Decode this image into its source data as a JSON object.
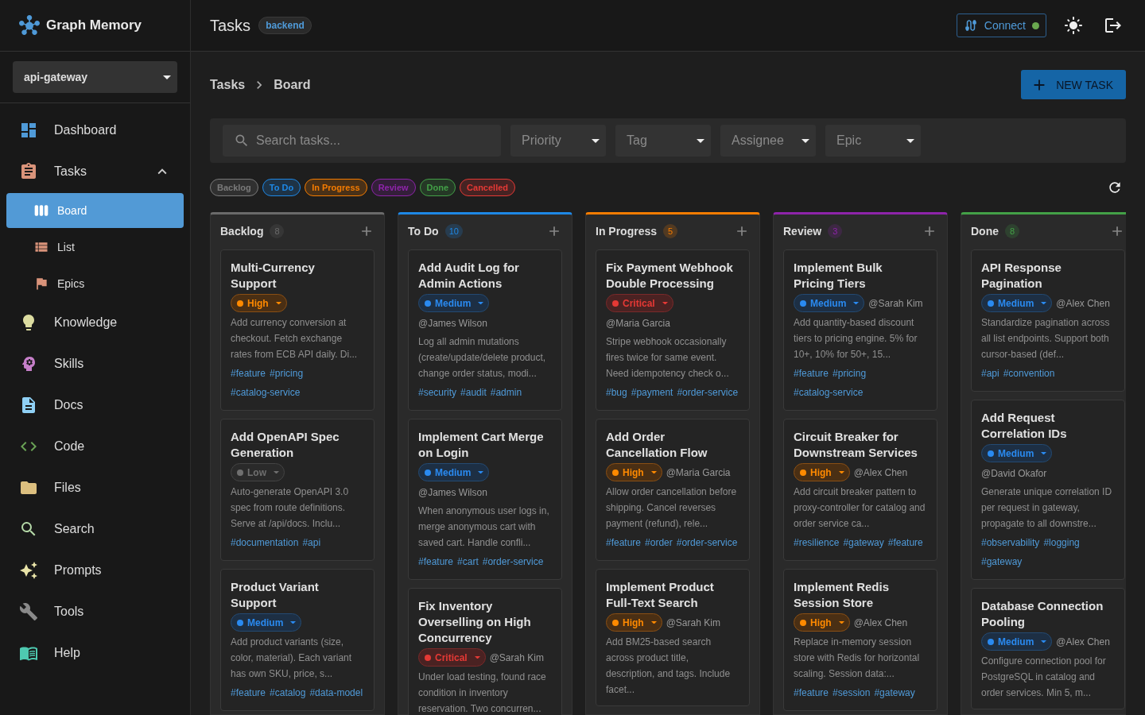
{
  "app": {
    "name": "Graph Memory"
  },
  "project_select": {
    "value": "api-gateway"
  },
  "sidebar": {
    "items": [
      {
        "label": "Dashboard",
        "color": "#4f9ad8",
        "selected": false
      },
      {
        "label": "Tasks",
        "color": "#d9937a",
        "selected": false,
        "expanded": true,
        "children": [
          {
            "label": "Board",
            "color": "#ffffff",
            "selected": true
          },
          {
            "label": "List",
            "color": "#d9937a",
            "selected": false
          },
          {
            "label": "Epics",
            "color": "#d9937a",
            "selected": false
          }
        ]
      },
      {
        "label": "Knowledge",
        "color": "#dcdca0",
        "selected": false
      },
      {
        "label": "Skills",
        "color": "#c67fc9",
        "selected": false
      },
      {
        "label": "Docs",
        "color": "#8fd0f5",
        "selected": false
      },
      {
        "label": "Code",
        "color": "#6aa356",
        "selected": false
      },
      {
        "label": "Files",
        "color": "#dcbf7f",
        "selected": false
      },
      {
        "label": "Search",
        "color": "#b5d9a8",
        "selected": false
      },
      {
        "label": "Prompts",
        "color": "#e8e3a8",
        "selected": false
      },
      {
        "label": "Tools",
        "color": "#8a8a8a",
        "selected": false
      },
      {
        "label": "Help",
        "color": "#4ec9b0",
        "selected": false
      }
    ]
  },
  "header": {
    "title": "Tasks",
    "badge": "backend",
    "connect": {
      "label": "Connect",
      "connected": true
    }
  },
  "breadcrumb": [
    "Tasks",
    "Board"
  ],
  "new_task_button": "NEW TASK",
  "filters": {
    "search": {
      "placeholder": "Search tasks..."
    },
    "selects": [
      "Priority",
      "Tag",
      "Assignee",
      "Epic"
    ]
  },
  "status_chips": [
    {
      "label": "Backlog",
      "color": "#7a7a7a"
    },
    {
      "label": "To Do",
      "color": "#1e88e5"
    },
    {
      "label": "In Progress",
      "color": "#f57c00"
    },
    {
      "label": "Review",
      "color": "#8e24aa"
    },
    {
      "label": "Done",
      "color": "#43a047"
    },
    {
      "label": "Cancelled",
      "color": "#e53935"
    }
  ],
  "columns": [
    {
      "title": "Backlog",
      "count": "8",
      "color": "#6a6a6a",
      "cards": [
        {
          "title": "Multi-Currency Support",
          "priority": {
            "label": "High",
            "kind": "high"
          },
          "description": "Add currency conversion at checkout. Fetch exchange rates from ECB API daily. Di...",
          "tags": [
            "#feature",
            "#pricing",
            "#catalog-service"
          ]
        },
        {
          "title": "Add OpenAPI Spec Generation",
          "priority": {
            "label": "Low",
            "kind": "low"
          },
          "description": "Auto-generate OpenAPI 3.0 spec from route definitions. Serve at /api/docs. Inclu...",
          "tags": [
            "#documentation",
            "#api"
          ]
        },
        {
          "title": "Product Variant Support",
          "priority": {
            "label": "Medium",
            "kind": "medium"
          },
          "description": "Add product variants (size, color, material). Each variant has own SKU, price, s...",
          "tags": [
            "#feature",
            "#catalog",
            "#data-model"
          ]
        }
      ]
    },
    {
      "title": "To Do",
      "count": "10",
      "color": "#1e88e5",
      "cards": [
        {
          "title": "Add Audit Log for Admin Actions",
          "priority": {
            "label": "Medium",
            "kind": "medium"
          },
          "assignee": "@James Wilson",
          "description": "Log all admin mutations (create/update/delete product, change order status, modi...",
          "tags": [
            "#security",
            "#audit",
            "#admin"
          ]
        },
        {
          "title": "Implement Cart Merge on Login",
          "priority": {
            "label": "Medium",
            "kind": "medium"
          },
          "assignee": "@James Wilson",
          "description": "When anonymous user logs in, merge anonymous cart with saved cart. Handle confli...",
          "tags": [
            "#feature",
            "#cart",
            "#order-service"
          ]
        },
        {
          "title": "Fix Inventory Overselling on High Concurrency",
          "priority": {
            "label": "Critical",
            "kind": "critical"
          },
          "assignee": "@Sarah Kim",
          "description": "Under load testing, found race condition in inventory reservation. Two concurren..."
        }
      ]
    },
    {
      "title": "In Progress",
      "count": "5",
      "color": "#f57c00",
      "cards": [
        {
          "title": "Fix Payment Webhook Double Processing",
          "priority": {
            "label": "Critical",
            "kind": "critical"
          },
          "assignee": "@Maria Garcia",
          "description": "Stripe webhook occasionally fires twice for same event. Need idempotency check o...",
          "tags": [
            "#bug",
            "#payment",
            "#order-service"
          ]
        },
        {
          "title": "Add Order Cancellation Flow",
          "priority": {
            "label": "High",
            "kind": "high"
          },
          "assignee": "@Maria Garcia",
          "description": "Allow order cancellation before shipping. Cancel reverses payment (refund), rele...",
          "tags": [
            "#feature",
            "#order",
            "#order-service"
          ]
        },
        {
          "title": "Implement Product Full-Text Search",
          "priority": {
            "label": "High",
            "kind": "high"
          },
          "assignee": "@Sarah Kim",
          "description": "Add BM25-based search across product title, description, and tags. Include facet..."
        }
      ]
    },
    {
      "title": "Review",
      "count": "3",
      "color": "#8e24aa",
      "cards": [
        {
          "title": "Implement Bulk Pricing Tiers",
          "priority": {
            "label": "Medium",
            "kind": "medium"
          },
          "assignee": "@Sarah Kim",
          "description": "Add quantity-based discount tiers to pricing engine. 5% for 10+, 10% for 50+, 15...",
          "tags": [
            "#feature",
            "#pricing",
            "#catalog-service"
          ]
        },
        {
          "title": "Circuit Breaker for Downstream Services",
          "priority": {
            "label": "High",
            "kind": "high"
          },
          "assignee": "@Alex Chen",
          "description": "Add circuit breaker pattern to proxy-controller for catalog and order service ca...",
          "tags": [
            "#resilience",
            "#gateway",
            "#feature"
          ]
        },
        {
          "title": "Implement Redis Session Store",
          "priority": {
            "label": "High",
            "kind": "high"
          },
          "assignee": "@Alex Chen",
          "description": "Replace in-memory session store with Redis for horizontal scaling. Session data:...",
          "tags": [
            "#feature",
            "#session",
            "#gateway"
          ]
        }
      ]
    },
    {
      "title": "Done",
      "count": "8",
      "color": "#43a047",
      "cards": [
        {
          "title": "API Response Pagination",
          "priority": {
            "label": "Medium",
            "kind": "medium"
          },
          "assignee": "@Alex Chen",
          "description": "Standardize pagination across all list endpoints. Support both cursor-based (def...",
          "tags": [
            "#api",
            "#convention"
          ]
        },
        {
          "title": "Add Request Correlation IDs",
          "priority": {
            "label": "Medium",
            "kind": "medium"
          },
          "assignee": "@David Okafor",
          "description": "Generate unique correlation ID per request in gateway, propagate to all downstre...",
          "tags": [
            "#observability",
            "#logging",
            "#gateway"
          ]
        },
        {
          "title": "Database Connection Pooling",
          "priority": {
            "label": "Medium",
            "kind": "medium"
          },
          "assignee": "@Alex Chen",
          "description": "Configure connection pool for PostgreSQL in catalog and order services. Min 5, m..."
        }
      ]
    }
  ]
}
